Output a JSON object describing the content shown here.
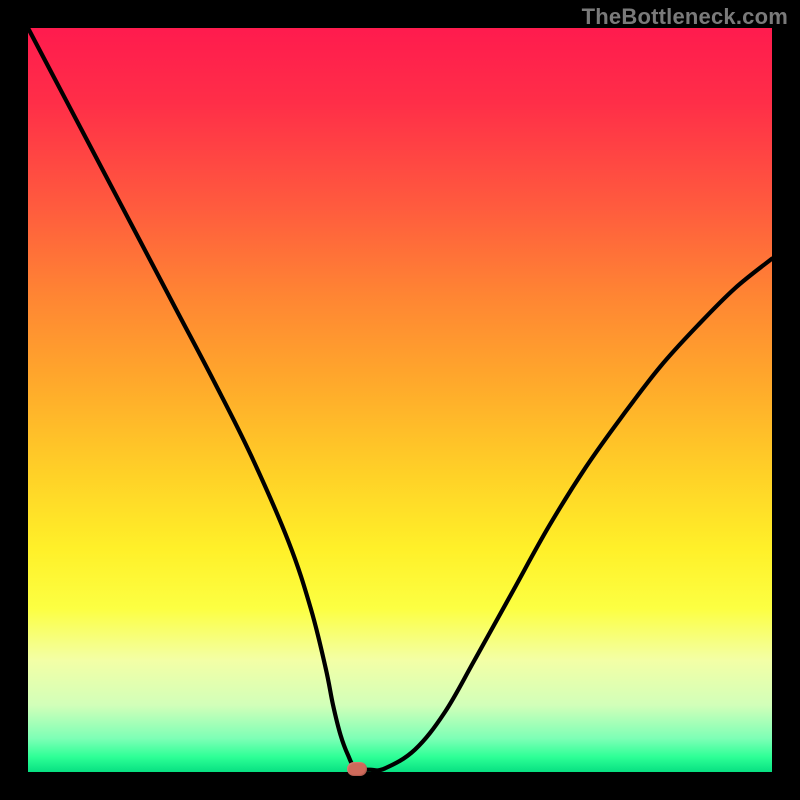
{
  "watermark": "TheBottleneck.com",
  "chart_data": {
    "type": "line",
    "title": "",
    "xlabel": "",
    "ylabel": "",
    "xlim": [
      0,
      100
    ],
    "ylim": [
      0,
      100
    ],
    "grid": false,
    "series": [
      {
        "name": "bottleneck-curve",
        "x": [
          0,
          5,
          10,
          15,
          20,
          25,
          30,
          35,
          38,
          40,
          41,
          42,
          43,
          44,
          46,
          48,
          52,
          56,
          60,
          65,
          70,
          75,
          80,
          85,
          90,
          95,
          100
        ],
        "values": [
          100,
          90.5,
          81,
          71.5,
          62,
          52.5,
          42.5,
          31,
          22,
          14,
          9,
          5,
          2.3,
          0.6,
          0.3,
          0.5,
          3,
          8,
          15,
          24,
          33,
          41,
          48,
          54.5,
          60,
          65,
          69
        ]
      }
    ],
    "marker": {
      "x": 44.2,
      "y": 0.4,
      "label": "optimal-point"
    }
  },
  "colors": {
    "curve": "#000000",
    "background_top": "#ff1b4e",
    "background_bottom": "#07e082",
    "marker": "#cf6a5b",
    "frame": "#000000"
  }
}
